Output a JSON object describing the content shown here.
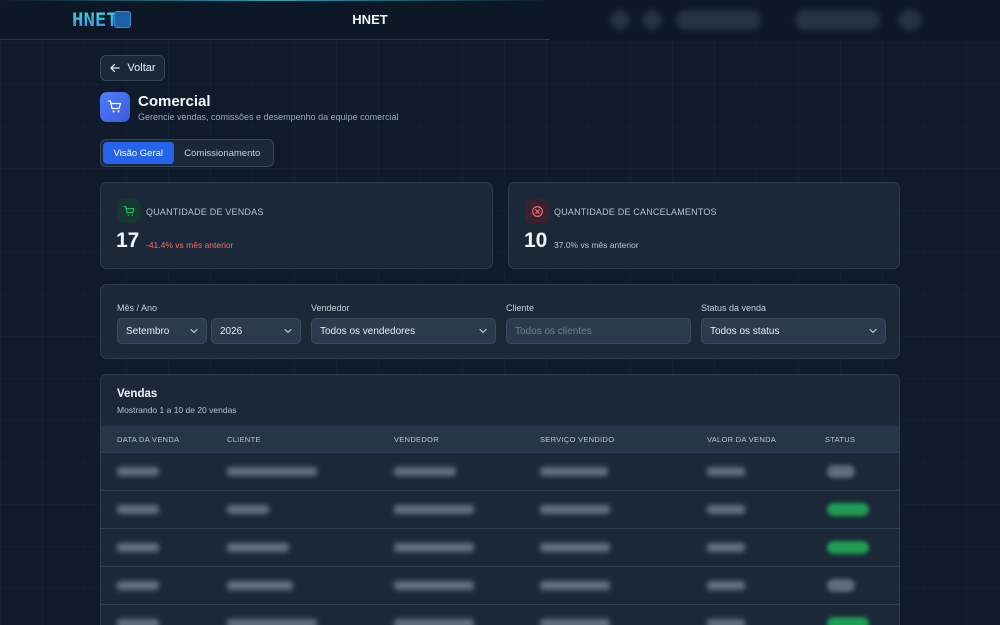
{
  "header": {
    "logo_text": "HNET",
    "brand": "HNET"
  },
  "back": {
    "label": "Voltar"
  },
  "page": {
    "title": "Comercial",
    "subtitle": "Gerencie vendas, comissões e desempenho da equipe comercial"
  },
  "tabs": [
    {
      "label": "Visão Geral",
      "active": true
    },
    {
      "label": "Comissionamento",
      "active": false
    }
  ],
  "stats": {
    "sales": {
      "label": "QUANTIDADE DE VENDAS",
      "value": "17",
      "delta": "-41.4% vs mês anterior",
      "delta_color": "#f26b6b",
      "icon": "cart-icon"
    },
    "cancellations": {
      "label": "QUANTIDADE DE CANCELAMENTOS",
      "value": "10",
      "delta": "37.0% vs mês anterior",
      "delta_color": "#b7c3cf",
      "icon": "x-circle-icon"
    }
  },
  "filters": {
    "period_label": "Mês / Ano",
    "month": "Setembro",
    "year": "2026",
    "seller_label": "Vendedor",
    "seller": "Todos os vendedores",
    "client_label": "Cliente",
    "client_placeholder": "Todos os clientes",
    "status_label": "Status da venda",
    "status": "Todos os status"
  },
  "sales_table": {
    "title": "Vendas",
    "subtitle": "Mostrando 1 a 10 de 20 vendas",
    "columns": [
      "DATA DA VENDA",
      "CLIENTE",
      "VENDEDOR",
      "SERVIÇO VENDIDO",
      "VALOR DA VENDA",
      "STATUS"
    ],
    "row_count_visible": 5,
    "status_colors": [
      "#9aa5b1",
      "#22c55e",
      "#22c55e",
      "#9aa5b1",
      "#22c55e"
    ]
  },
  "colors": {
    "accent": "#2563eb",
    "background": "#0f1b2b",
    "card": "#1a2838",
    "success": "#22c55e",
    "danger": "#f26b6b"
  }
}
